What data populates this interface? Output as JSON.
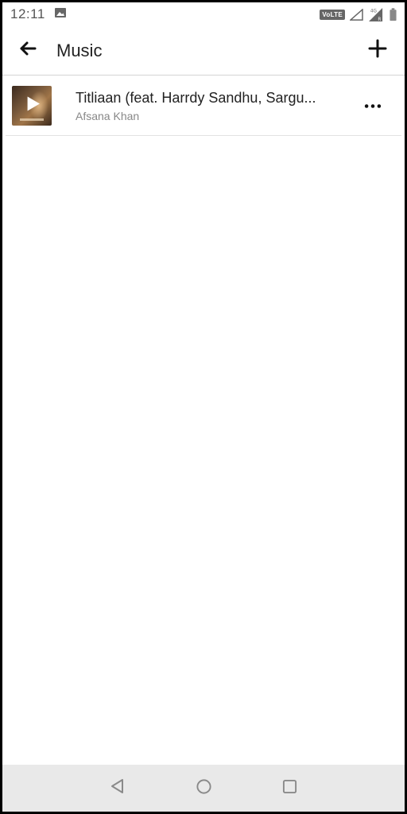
{
  "status_bar": {
    "time": "12:11",
    "network_badge": "VoLTE",
    "icons": [
      "image-icon",
      "signal-icon",
      "data-signal-icon",
      "battery-icon"
    ]
  },
  "app_bar": {
    "title": "Music",
    "back_icon": "arrow-left-icon",
    "add_icon": "plus-icon"
  },
  "tracks": [
    {
      "title": "Titliaan (feat. Harrdy Sandhu, Sargu...",
      "artist": "Afsana Khan",
      "art_icon": "play-icon",
      "menu_icon": "more-horizontal-icon"
    }
  ],
  "nav_bar": {
    "icons": [
      "back-triangle-icon",
      "home-circle-icon",
      "recents-square-icon"
    ]
  },
  "colors": {
    "text_primary": "#222222",
    "text_secondary": "#888888",
    "divider": "#e2e2e2",
    "nav_background": "#e9e9e9",
    "status_text": "#555555"
  }
}
